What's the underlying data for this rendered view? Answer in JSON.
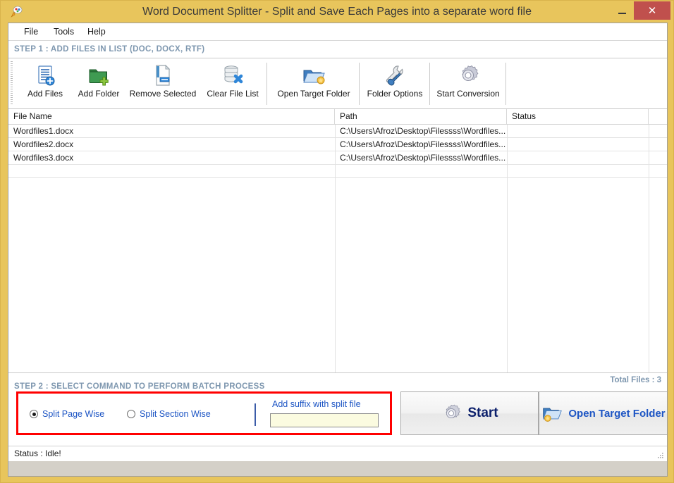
{
  "window": {
    "title": "Word Document Splitter - Split and Save Each Pages into a separate word file",
    "icon": "app-icon",
    "minimize_label": "–",
    "maximize_label": "□",
    "close_label": "✕",
    "frame_color": "#e8c55c",
    "close_color": "#c0504d"
  },
  "menubar": {
    "items": [
      {
        "label": "File"
      },
      {
        "label": "Tools"
      },
      {
        "label": "Help"
      }
    ]
  },
  "step1": {
    "header": "STEP 1 : ADD FILES IN LIST (DOC, DOCX, RTF)",
    "header_color": "#7e97af"
  },
  "toolbar": {
    "buttons": [
      {
        "label": "Add Files",
        "icon": "add-files-icon"
      },
      {
        "label": "Add Folder",
        "icon": "add-folder-icon"
      },
      {
        "label": "Remove Selected",
        "icon": "remove-selected-icon"
      },
      {
        "label": "Clear File List",
        "icon": "clear-file-list-icon"
      },
      {
        "label": "Open Target Folder",
        "icon": "open-target-folder-icon"
      },
      {
        "label": "Folder Options",
        "icon": "folder-options-icon"
      },
      {
        "label": "Start Conversion",
        "icon": "start-conversion-icon"
      }
    ]
  },
  "filelist": {
    "columns": [
      {
        "label": "File Name"
      },
      {
        "label": "Path"
      },
      {
        "label": "Status"
      }
    ],
    "rows": [
      {
        "name": "Wordfiles1.docx",
        "path": "C:\\Users\\Afroz\\Desktop\\Filessss\\Wordfiles...",
        "status": ""
      },
      {
        "name": "Wordfiles2.docx",
        "path": "C:\\Users\\Afroz\\Desktop\\Filessss\\Wordfiles...",
        "status": ""
      },
      {
        "name": "Wordfiles3.docx",
        "path": "C:\\Users\\Afroz\\Desktop\\Filessss\\Wordfiles...",
        "status": ""
      }
    ],
    "total_files": "Total Files : 3"
  },
  "step2": {
    "header": "STEP 2 : SELECT COMMAND TO PERFORM BATCH PROCESS",
    "highlight_color": "#ff0000",
    "radios": [
      {
        "label": "Split Page Wise",
        "selected": true
      },
      {
        "label": "Split Section Wise",
        "selected": false
      }
    ],
    "suffix": {
      "label": "Add suffix with split file",
      "value": "",
      "placeholder": ""
    },
    "start_button": {
      "label": "Start",
      "icon": "gear-icon"
    },
    "open_target_button": {
      "label": "Open Target Folder",
      "icon": "open-folder-icon"
    }
  },
  "statusbar": {
    "text": "Status  :   Idle!"
  }
}
